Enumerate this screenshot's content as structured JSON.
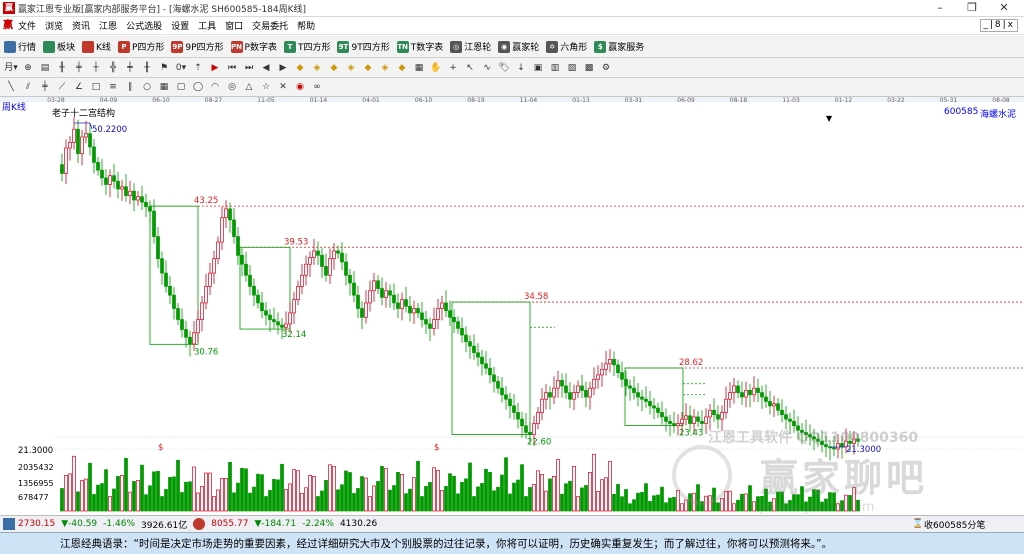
{
  "window": {
    "app_icon": "赢",
    "title": "赢家江恩专业版[赢家内部服务平台] - [海螺水泥  SH600585-184周K线]",
    "controls": [
      "–",
      "❐",
      "✕"
    ]
  },
  "menu": {
    "logo": "赢",
    "items": [
      "文件",
      "浏览",
      "资讯",
      "江恩",
      "公式选股",
      "设置",
      "工具",
      "窗口",
      "交易委托",
      "帮助"
    ],
    "mdi_controls": "_|8|x"
  },
  "toolbar": {
    "items": [
      {
        "icon": "grid-icon",
        "label": "行情",
        "color": "#3a6ea5"
      },
      {
        "icon": "blocks-icon",
        "label": "板块",
        "color": "#2e8b57"
      },
      {
        "icon": "kline-icon",
        "label": "K线",
        "color": "#c0392b"
      },
      {
        "icon": "p-square-icon",
        "label": "P四方形",
        "color": "#c0392b",
        "glyph": "P"
      },
      {
        "icon": "9p-square-icon",
        "label": "9P四方形",
        "color": "#c0392b",
        "glyph": "9P"
      },
      {
        "icon": "pn-icon",
        "label": "P数字表",
        "color": "#c0392b",
        "glyph": "PN"
      },
      {
        "icon": "t-square-icon",
        "label": "T四方形",
        "color": "#2e8b57",
        "glyph": "T"
      },
      {
        "icon": "9t-square-icon",
        "label": "9T四方形",
        "color": "#2e8b57",
        "glyph": "9T"
      },
      {
        "icon": "tn-icon",
        "label": "T数字表",
        "color": "#2e8b57",
        "glyph": "TN"
      },
      {
        "icon": "gann-wheel-icon",
        "label": "江恩轮",
        "color": "#555",
        "glyph": "◎"
      },
      {
        "icon": "winner-wheel-icon",
        "label": "赢家轮",
        "color": "#555",
        "glyph": "◉"
      },
      {
        "icon": "hexagon-icon",
        "label": "六角形",
        "color": "#555",
        "glyph": "✡"
      },
      {
        "icon": "dollar-icon",
        "label": "赢家服务",
        "color": "#2e8b57",
        "glyph": "$"
      }
    ]
  },
  "chart": {
    "period_label": "周K线",
    "indicator_label": "老子十二宫结构",
    "stock_code": "600585",
    "stock_name": "海螺水泥",
    "date_ticks": [
      "03-28",
      "04-09",
      "06-10",
      "08-27",
      "11-05",
      "01-14",
      "04-01",
      "06-10",
      "08-19",
      "11-04",
      "01-13",
      "03-31",
      "06-09",
      "08-18",
      "11-03",
      "01-12",
      "03-22",
      "05-31",
      "08-08"
    ],
    "price_labels": {
      "high_label": "50.2200",
      "low_label": "21.3000",
      "axis_low": "21.3000",
      "boxes": [
        {
          "top": "43.25",
          "bottom": "30.76"
        },
        {
          "top": "39.53",
          "bottom": "32.14"
        },
        {
          "top": "34.58",
          "bottom": "22.60"
        },
        {
          "top": "28.62",
          "bottom": "23.43"
        }
      ]
    },
    "volume_axis": [
      "2035432",
      "1356955",
      "678477"
    ],
    "dollar_marker": "$",
    "watermark_1": "江恩工具软件 QQ1100800360",
    "watermark_2": "赢家聊吧",
    "watermark_3": "jiaoba.yixi36.com",
    "colors": {
      "up": "#d0021b",
      "down": "#009900",
      "box": "#009900",
      "resistance": "#e02020",
      "label_blue": "#1010c0"
    }
  },
  "status": {
    "sh_index": "2730.15",
    "sh_change": "▼-40.59",
    "sh_pct": "-1.46%",
    "sh_amount": "3926.61亿",
    "sz_index": "8055.77",
    "sz_change": "▼-184.71",
    "sz_pct": "-2.24%",
    "sz_amount": "4130.26",
    "right_text": "收600585分笔"
  },
  "quote": {
    "text": "江恩经典语录：“时间是决定市场走势的重要因素，经过详细研究大市及个别股票的过往记录，你将可以证明，历史确实重复发生；而了解过往，你将可以预测将来。”。"
  }
}
